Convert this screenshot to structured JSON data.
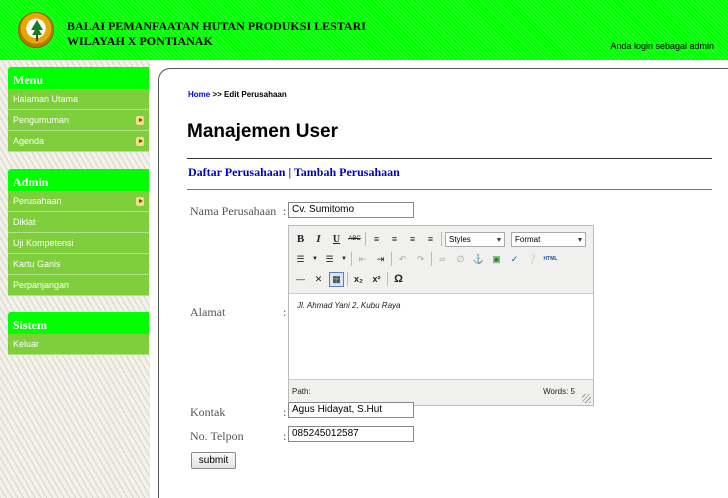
{
  "header": {
    "title_line1": "BALAI PEMANFAATAN HUTAN PRODUKSI LESTARI",
    "title_line2": "WILAYAH X PONTIANAK",
    "login_status": "Anda login sebagai admin",
    "accent_color": "#00ff00"
  },
  "sidebar": {
    "groups": [
      {
        "title": "Menu",
        "items": [
          {
            "label": "Halaman Utama",
            "has_arrow": false
          },
          {
            "label": "Pengumuman",
            "has_arrow": true
          },
          {
            "label": "Agenda",
            "has_arrow": true
          }
        ]
      },
      {
        "title": "Admin",
        "items": [
          {
            "label": "Perusahaan",
            "has_arrow": true
          },
          {
            "label": "Diklat",
            "has_arrow": false
          },
          {
            "label": "Uji Kompetensi",
            "has_arrow": false
          },
          {
            "label": "Kartu Ganis",
            "has_arrow": false
          },
          {
            "label": "Perpanjangan",
            "has_arrow": false
          }
        ]
      },
      {
        "title": "Sistem",
        "items": [
          {
            "label": "Keluar",
            "has_arrow": false
          }
        ]
      }
    ],
    "item_color": "#7fce3b"
  },
  "breadcrumb": {
    "home": "Home",
    "separator": ">>",
    "current": "Edit Perusahaan"
  },
  "page_title": "Manajemen User",
  "subnav": {
    "list_link": "Daftar Perusahaan",
    "separator": "|",
    "add_link": "Tambah Perusahaan"
  },
  "form": {
    "nama": {
      "label": "Nama Perusahaan",
      "value": "Cv. Sumitomo"
    },
    "alamat": {
      "label": "Alamat",
      "value": "Jl. Ahmad Yani 2, Kubu Raya"
    },
    "kontak": {
      "label": "Kontak",
      "value": "Agus Hidayat, S.Hut"
    },
    "telpon": {
      "label": "No. Telpon",
      "value": "085245012587"
    },
    "colon": ":",
    "submit_label": "submit"
  },
  "editor": {
    "styles_label": "Styles",
    "format_label": "Format",
    "path_label": "Path:",
    "words_label": "Words: 5",
    "toolbar_icons": [
      "bold-icon",
      "italic-icon",
      "underline-icon",
      "strikethrough-icon",
      "align-left-icon",
      "align-center-icon",
      "align-right-icon",
      "align-justify-icon",
      "bullet-list-icon",
      "numbered-list-icon",
      "outdent-icon",
      "indent-icon",
      "undo-icon",
      "redo-icon",
      "link-icon",
      "unlink-icon",
      "anchor-icon",
      "image-icon",
      "cleanup-icon",
      "help-icon",
      "html-icon",
      "horizontal-rule-icon",
      "remove-format-icon",
      "visual-aid-icon",
      "subscript-icon",
      "superscript-icon",
      "special-char-icon"
    ]
  }
}
